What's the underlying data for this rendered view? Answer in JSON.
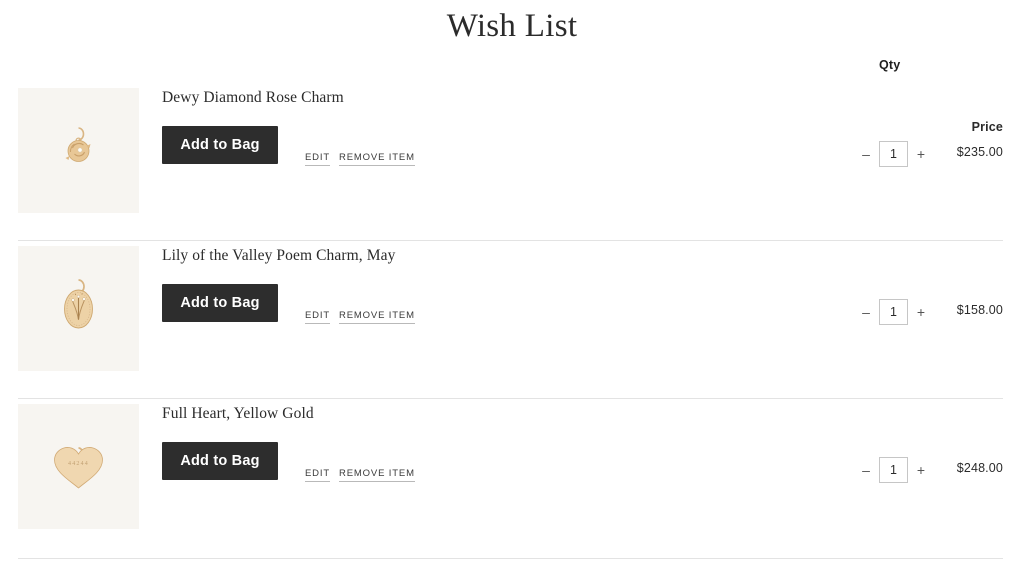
{
  "page": {
    "title": "Wish List"
  },
  "columns": {
    "qty_label": "Qty",
    "price_label": "Price"
  },
  "item_actions": {
    "add_to_bag_label": "Add to Bag",
    "edit_label": "EDIT",
    "remove_label": "REMOVE ITEM",
    "decrease_label": "–",
    "increase_label": "+"
  },
  "colors": {
    "button_background": "#2d2d2d",
    "button_text": "#ffffff",
    "thumbnail_background": "#f7f5f1",
    "divider": "#e3e3e3",
    "gold": "#e3c28f",
    "text": "#2b2b2b"
  },
  "items": [
    {
      "title": "Dewy Diamond Rose Charm",
      "qty": "1",
      "price": "$235.00",
      "image": "rose-charm-pendant"
    },
    {
      "title": "Lily of the Valley Poem Charm, May",
      "qty": "1",
      "price": "$158.00",
      "image": "oval-lily-pendant"
    },
    {
      "title": "Full Heart, Yellow Gold",
      "qty": "1",
      "price": "$248.00",
      "image": "heart-charm-pendant"
    }
  ]
}
